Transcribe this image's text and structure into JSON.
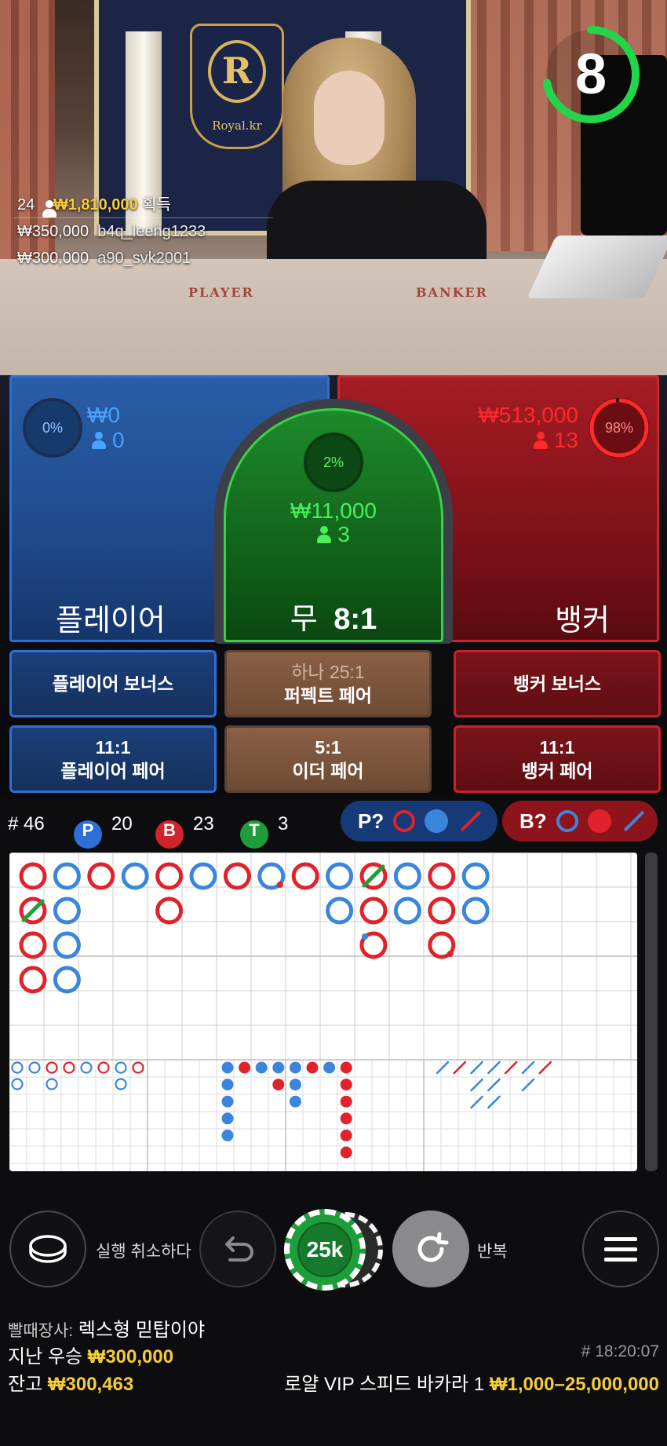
{
  "video": {
    "crest_letter": "R",
    "crest_text": "Royal.kr",
    "felt_player": "PLAYER",
    "felt_banker": "BANKER",
    "timer": "8",
    "timer_fraction": 0.72,
    "winners": {
      "count": "24",
      "total": "₩1,810,000",
      "suffix": "획득",
      "list": [
        {
          "amount": "₩350,000",
          "user": "b4q_leehg1233"
        },
        {
          "amount": "₩300,000",
          "user": "a90_svk2001"
        }
      ]
    }
  },
  "bets": {
    "player": {
      "label": "플레이어",
      "percent": "0%",
      "amount": "₩0",
      "count": "0",
      "fraction": 0.0
    },
    "tie": {
      "label": "무",
      "odds": "8:1",
      "percent": "2%",
      "amount": "₩11,000",
      "count": "3",
      "fraction": 0.02
    },
    "banker": {
      "label": "뱅커",
      "percent": "98%",
      "amount": "₩513,000",
      "count": "13",
      "fraction": 0.98
    }
  },
  "side_bets": {
    "player_bonus": "플레이어 보너스",
    "perfect_pair_odds": "하나 25:1",
    "perfect_pair": "퍼펙트 페어",
    "banker_bonus": "뱅커 보너스",
    "player_pair_odds": "11:1",
    "player_pair": "플레이어 페어",
    "either_pair_odds": "5:1",
    "either_pair": "이더 페어",
    "banker_pair_odds": "11:1",
    "banker_pair": "뱅커 페어"
  },
  "stats": {
    "round_prefix": "#",
    "round": "46",
    "p_letter": "P",
    "p_count": "20",
    "b_letter": "B",
    "b_count": "23",
    "t_letter": "T",
    "t_count": "3",
    "player_predict": "P?",
    "banker_predict": "B?"
  },
  "colors": {
    "player": "#2d6fd6",
    "banker": "#d0242c",
    "tie": "#3ad14a",
    "gold": "#f5cc3a",
    "road_red": "#e0222b",
    "road_blue": "#3b86dc",
    "road_green": "#1e9e3a"
  },
  "roadmap": {
    "bead_plate": [
      {
        "col": 0,
        "row": 0,
        "c": "R"
      },
      {
        "col": 0,
        "row": 1,
        "c": "R",
        "tie": true
      },
      {
        "col": 0,
        "row": 2,
        "c": "R"
      },
      {
        "col": 0,
        "row": 3,
        "c": "R"
      },
      {
        "col": 1,
        "row": 0,
        "c": "B"
      },
      {
        "col": 1,
        "row": 1,
        "c": "B"
      },
      {
        "col": 1,
        "row": 2,
        "c": "B"
      },
      {
        "col": 1,
        "row": 3,
        "c": "B"
      },
      {
        "col": 2,
        "row": 0,
        "c": "R"
      },
      {
        "col": 3,
        "row": 0,
        "c": "B"
      },
      {
        "col": 4,
        "row": 0,
        "c": "R"
      },
      {
        "col": 4,
        "row": 1,
        "c": "R"
      },
      {
        "col": 5,
        "row": 0,
        "c": "B"
      },
      {
        "col": 6,
        "row": 0,
        "c": "R"
      },
      {
        "col": 7,
        "row": 0,
        "c": "B",
        "pair": "R"
      },
      {
        "col": 8,
        "row": 0,
        "c": "R"
      },
      {
        "col": 9,
        "row": 0,
        "c": "B"
      },
      {
        "col": 9,
        "row": 1,
        "c": "B"
      },
      {
        "col": 10,
        "row": 0,
        "c": "R",
        "tie": true
      },
      {
        "col": 10,
        "row": 1,
        "c": "R"
      },
      {
        "col": 10,
        "row": 2,
        "c": "R",
        "pair": "B"
      },
      {
        "col": 11,
        "row": 0,
        "c": "B"
      },
      {
        "col": 11,
        "row": 1,
        "c": "B"
      },
      {
        "col": 12,
        "row": 0,
        "c": "R"
      },
      {
        "col": 12,
        "row": 1,
        "c": "R"
      },
      {
        "col": 12,
        "row": 2,
        "c": "R",
        "pair": "R"
      },
      {
        "col": 13,
        "row": 0,
        "c": "B"
      },
      {
        "col": 13,
        "row": 1,
        "c": "B"
      }
    ],
    "big_eye": [
      {
        "col": 0,
        "row": 0,
        "c": "B"
      },
      {
        "col": 0,
        "row": 1,
        "c": "B"
      },
      {
        "col": 1,
        "row": 0,
        "c": "B"
      },
      {
        "col": 2,
        "row": 0,
        "c": "R"
      },
      {
        "col": 2,
        "row": 1,
        "c": "B"
      },
      {
        "col": 3,
        "row": 0,
        "c": "R"
      },
      {
        "col": 4,
        "row": 0,
        "c": "B"
      },
      {
        "col": 5,
        "row": 0,
        "c": "R"
      },
      {
        "col": 6,
        "row": 0,
        "c": "B"
      },
      {
        "col": 6,
        "row": 1,
        "c": "B"
      },
      {
        "col": 7,
        "row": 0,
        "c": "R"
      }
    ],
    "small_road": [
      {
        "col": 0,
        "row": 0,
        "c": "B"
      },
      {
        "col": 0,
        "row": 1,
        "c": "B"
      },
      {
        "col": 0,
        "row": 2,
        "c": "B"
      },
      {
        "col": 0,
        "row": 3,
        "c": "B"
      },
      {
        "col": 0,
        "row": 4,
        "c": "B"
      },
      {
        "col": 1,
        "row": 0,
        "c": "R"
      },
      {
        "col": 2,
        "row": 0,
        "c": "B"
      },
      {
        "col": 3,
        "row": 0,
        "c": "B"
      },
      {
        "col": 3,
        "row": 1,
        "c": "R"
      },
      {
        "col": 4,
        "row": 0,
        "c": "B"
      },
      {
        "col": 4,
        "row": 1,
        "c": "B"
      },
      {
        "col": 4,
        "row": 2,
        "c": "B"
      },
      {
        "col": 5,
        "row": 0,
        "c": "R"
      },
      {
        "col": 6,
        "row": 0,
        "c": "B"
      },
      {
        "col": 7,
        "row": 0,
        "c": "R"
      },
      {
        "col": 7,
        "row": 1,
        "c": "R"
      },
      {
        "col": 7,
        "row": 2,
        "c": "R"
      },
      {
        "col": 7,
        "row": 3,
        "c": "R"
      },
      {
        "col": 7,
        "row": 4,
        "c": "R"
      },
      {
        "col": 7,
        "row": 5,
        "c": "R"
      }
    ],
    "cockroach": [
      {
        "col": 0,
        "row": 0,
        "c": "B"
      },
      {
        "col": 1,
        "row": 0,
        "c": "R"
      },
      {
        "col": 2,
        "row": 0,
        "c": "B"
      },
      {
        "col": 2,
        "row": 1,
        "c": "B"
      },
      {
        "col": 2,
        "row": 2,
        "c": "B"
      },
      {
        "col": 3,
        "row": 0,
        "c": "B"
      },
      {
        "col": 3,
        "row": 1,
        "c": "B"
      },
      {
        "col": 3,
        "row": 2,
        "c": "B"
      },
      {
        "col": 4,
        "row": 0,
        "c": "R"
      },
      {
        "col": 5,
        "row": 0,
        "c": "B"
      },
      {
        "col": 5,
        "row": 1,
        "c": "B"
      },
      {
        "col": 6,
        "row": 0,
        "c": "R"
      }
    ]
  },
  "controls": {
    "undo_label": "실행 취소하다",
    "chip_value": "25k",
    "repeat_label": "반복"
  },
  "footer": {
    "dealer_prefix": "빨때장사:",
    "dealer_name": "렉스형 믿탑이야",
    "last_win_label": "지난 우승",
    "last_win": "₩300,000",
    "round_time": "# 18:20:07",
    "balance_label": "잔고",
    "balance": "₩300,463",
    "table_name": "로얄 VIP 스피드 바카라 1",
    "limits": "₩1,000–25,000,000"
  }
}
